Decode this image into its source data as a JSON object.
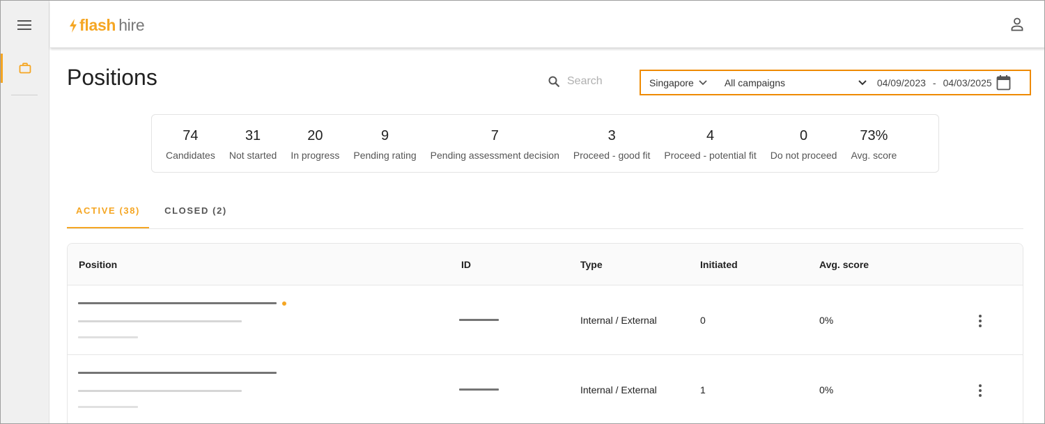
{
  "app": {
    "logo_flash": "flash",
    "logo_hire": "hire"
  },
  "page": {
    "title": "Positions"
  },
  "search": {
    "placeholder": "Search"
  },
  "filters": {
    "location": "Singapore",
    "campaign": "All campaigns",
    "date_from": "04/09/2023",
    "date_separator": "-",
    "date_to": "04/03/2025"
  },
  "stats": [
    {
      "value": "74",
      "label": "Candidates"
    },
    {
      "value": "31",
      "label": "Not started"
    },
    {
      "value": "20",
      "label": "In progress"
    },
    {
      "value": "9",
      "label": "Pending rating"
    },
    {
      "value": "7",
      "label": "Pending assessment decision"
    },
    {
      "value": "3",
      "label": "Proceed - good fit"
    },
    {
      "value": "4",
      "label": "Proceed - potential fit"
    },
    {
      "value": "0",
      "label": "Do not proceed"
    },
    {
      "value": "73%",
      "label": "Avg. score"
    }
  ],
  "tabs": {
    "active": "ACTIVE (38)",
    "closed": "CLOSED (2)"
  },
  "table": {
    "headers": {
      "position": "Position",
      "id": "ID",
      "type": "Type",
      "initiated": "Initiated",
      "avg_score": "Avg. score"
    },
    "rows": [
      {
        "type": "Internal / External",
        "initiated": "0",
        "avg_score": "0%"
      },
      {
        "type": "Internal / External",
        "initiated": "1",
        "avg_score": "0%"
      }
    ]
  },
  "colors": {
    "accent": "#f5a623",
    "highlight_border": "#ee8a00"
  }
}
